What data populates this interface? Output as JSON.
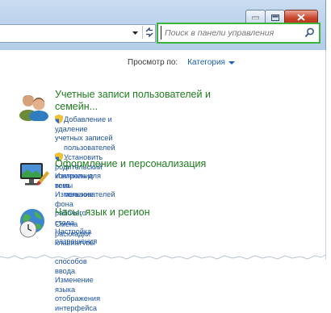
{
  "window": {
    "caption_buttons": [
      "minimize",
      "maximize",
      "close"
    ],
    "accent_color": "#3cb33c"
  },
  "search": {
    "placeholder": "Поиск в панели управления"
  },
  "view": {
    "label": "Просмотр по:",
    "value": "Категория"
  },
  "categories": [
    {
      "icon": "user-accounts-icon",
      "title": "Учетные записи пользователей и семейн...",
      "title_line1": "Учетные записи пользователей и",
      "title_line2": "семейн...",
      "links": [
        {
          "line1": "Добавление и удаление учетных записей",
          "line2": "пользователей",
          "shield": true
        },
        {
          "line1": "Установить родительский контроль для всех",
          "line2": "пользователей",
          "shield": true
        }
      ]
    },
    {
      "icon": "appearance-icon",
      "title": "Оформление и персонализация",
      "links": [
        {
          "text": "Изменение темы"
        },
        {
          "text": "Изменение фона рабочего стола"
        },
        {
          "text": "Настройка разрешения экрана"
        }
      ]
    },
    {
      "icon": "clock-language-region-icon",
      "title": "Часы, язык и регион",
      "links": [
        {
          "line1": "Смена раскладки клавиатуры или других",
          "line2": "способов ввода"
        },
        {
          "text": "Изменение языка отображения интерфейса"
        }
      ]
    }
  ]
}
